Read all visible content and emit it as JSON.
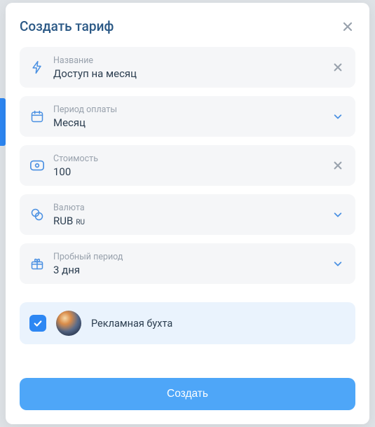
{
  "modal": {
    "title": "Создать тариф"
  },
  "fields": {
    "name": {
      "label": "Название",
      "value": "Доступ на месяц"
    },
    "period": {
      "label": "Период оплаты",
      "value": "Месяц"
    },
    "price": {
      "label": "Стоимость",
      "value": "100"
    },
    "currency": {
      "label": "Валюта",
      "value": "RUB",
      "suffix": "RU"
    },
    "trial": {
      "label": "Пробный период",
      "value": "3 дня"
    }
  },
  "channel": {
    "checked": true,
    "name": "Рекламная бухта"
  },
  "actions": {
    "submit": "Создать"
  }
}
